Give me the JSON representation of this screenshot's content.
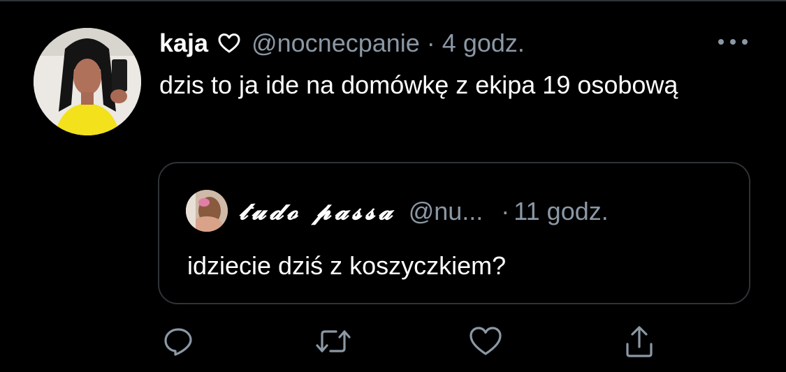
{
  "tweet": {
    "author": {
      "display_name": "kaja",
      "badge_icon": "heart-outline-icon",
      "handle": "@nocnecpanie"
    },
    "separator": "·",
    "time": "4 godz.",
    "menu_icon": "more-horizontal-icon",
    "text": "dzis to ja ide na domówkę z ekipa 19 osobową"
  },
  "quoted_tweet": {
    "display_name": "𝓽𝓾𝓭𝓸 𝓹𝓪𝓼𝓼𝓪",
    "handle": "@nu...",
    "separator": "·",
    "time": "11 godz.",
    "text": "idziecie dziś z koszyczkiem?"
  },
  "actions": {
    "reply_icon": "reply-icon",
    "retweet_icon": "retweet-icon",
    "like_icon": "heart-icon",
    "share_icon": "share-icon"
  },
  "colors": {
    "background": "#000000",
    "text_primary": "#ffffff",
    "text_secondary": "#8b98a5",
    "border": "#2f3336",
    "icon": "#8b98a5"
  }
}
